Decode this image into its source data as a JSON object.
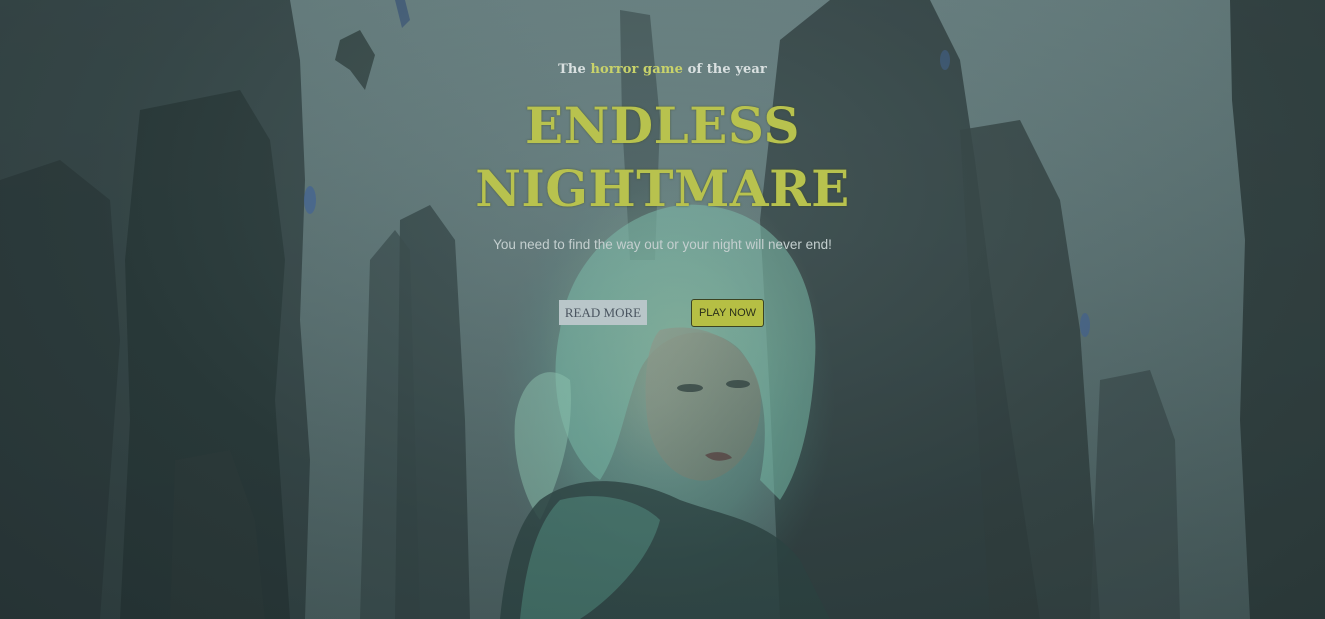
{
  "hero": {
    "tagline_prefix": "The ",
    "tagline_accent": "horror game",
    "tagline_suffix": " of the year",
    "title_line1": "ENDLESS",
    "title_line2": "NIGHTMARE",
    "subtitle": "You need to find the way out or your night will never end!"
  },
  "buttons": {
    "read_more": "READ MORE",
    "play_now": "PLAY NOW"
  },
  "colors": {
    "accent": "#c8d26a",
    "title": "#b8c24e",
    "play_button": "#b6bf44",
    "read_button": "#b9c6c9"
  },
  "icons": {
    "background": "dark-spires-figure-illustration"
  }
}
